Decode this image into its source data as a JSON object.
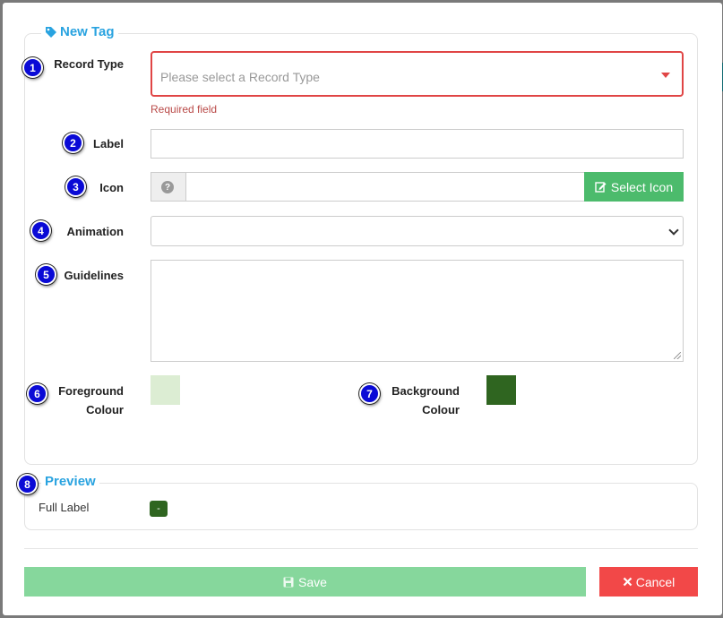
{
  "form": {
    "legend": "New Tag",
    "record_type": {
      "number": "1",
      "label": "Record Type",
      "placeholder": "Please select a Record Type",
      "error": "Required field"
    },
    "label_field": {
      "number": "2",
      "label": "Label",
      "value": ""
    },
    "icon_field": {
      "number": "3",
      "label": "Icon",
      "addon": "?",
      "value": "",
      "button": "Select Icon"
    },
    "animation": {
      "number": "4",
      "label": "Animation",
      "value": ""
    },
    "guidelines": {
      "number": "5",
      "label": "Guidelines",
      "value": ""
    },
    "foreground": {
      "number": "6",
      "label_line1": "Foreground",
      "label_line2": "Colour",
      "color": "#dcedd3"
    },
    "background": {
      "number": "7",
      "label_line1": "Background",
      "label_line2": "Colour",
      "color": "#2f6520"
    }
  },
  "preview": {
    "number": "8",
    "legend": "Preview",
    "full_label": "Full Label",
    "pill_text": "-"
  },
  "footer": {
    "save": "Save",
    "cancel": "Cancel"
  },
  "colors": {
    "accent": "#29a3e0",
    "badge": "#0a0ad6",
    "error": "#e04545",
    "save": "#86d79c",
    "cancel": "#f24848",
    "select_icon": "#4cbb6c"
  },
  "icons": [
    "tag-icon",
    "question-icon",
    "edit-icon",
    "chevron-down-icon",
    "caret-down-icon",
    "save-icon",
    "close-icon"
  ]
}
